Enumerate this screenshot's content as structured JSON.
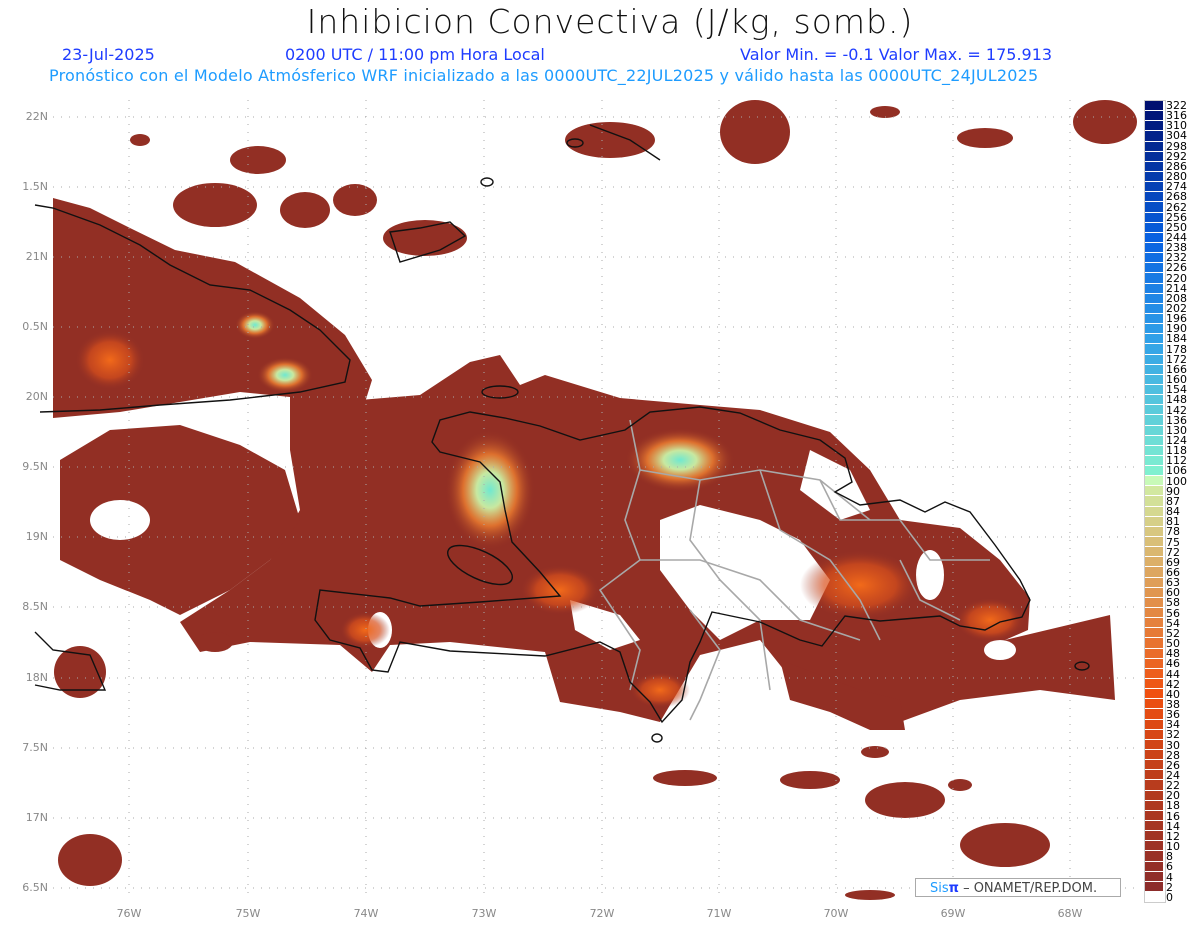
{
  "header": {
    "title": "Inhibicion Convectiva (J/kg, somb.)",
    "date": "23-Jul-2025",
    "time": "0200 UTC / 11:00 pm Hora Local",
    "minmax": "Valor Min. = -0.1  Valor Max. = 175.913",
    "model_line": "Pronóstico con el Modelo Atmósferico WRF inicializado a las 0000UTC_22JUL2025 y válido hasta las  0000UTC_24JUL2025"
  },
  "axes": {
    "lat_labels": [
      "22N",
      "1.5N",
      "21N",
      "0.5N",
      "20N",
      "9.5N",
      "19N",
      "8.5N",
      "18N",
      "7.5N",
      "17N",
      "6.5N"
    ],
    "lon_labels": [
      "76W",
      "75W",
      "74W",
      "73W",
      "72W",
      "71W",
      "70W",
      "69W",
      "68W"
    ]
  },
  "colorbar": {
    "levels": [
      "0",
      "2",
      "4",
      "6",
      "8",
      "10",
      "12",
      "14",
      "16",
      "18",
      "20",
      "22",
      "24",
      "26",
      "28",
      "30",
      "32",
      "34",
      "36",
      "38",
      "40",
      "42",
      "44",
      "46",
      "48",
      "50",
      "52",
      "54",
      "56",
      "58",
      "60",
      "63",
      "66",
      "69",
      "72",
      "75",
      "78",
      "81",
      "84",
      "87",
      "90",
      "100",
      "106",
      "112",
      "118",
      "124",
      "130",
      "136",
      "142",
      "148",
      "154",
      "160",
      "166",
      "172",
      "178",
      "184",
      "190",
      "196",
      "202",
      "208",
      "214",
      "220",
      "226",
      "232",
      "238",
      "244",
      "250",
      "256",
      "262",
      "268",
      "274",
      "280",
      "286",
      "292",
      "298",
      "304",
      "310",
      "316",
      "322"
    ]
  },
  "colors": {
    "field_base": "#922f24",
    "field_orange": "#e8561a",
    "coast": "#111111",
    "borders": "#a8a8a8"
  },
  "credit": {
    "sis": "Sis",
    "pi": "π",
    "rest": " – ONAMET/REP.DOM."
  }
}
